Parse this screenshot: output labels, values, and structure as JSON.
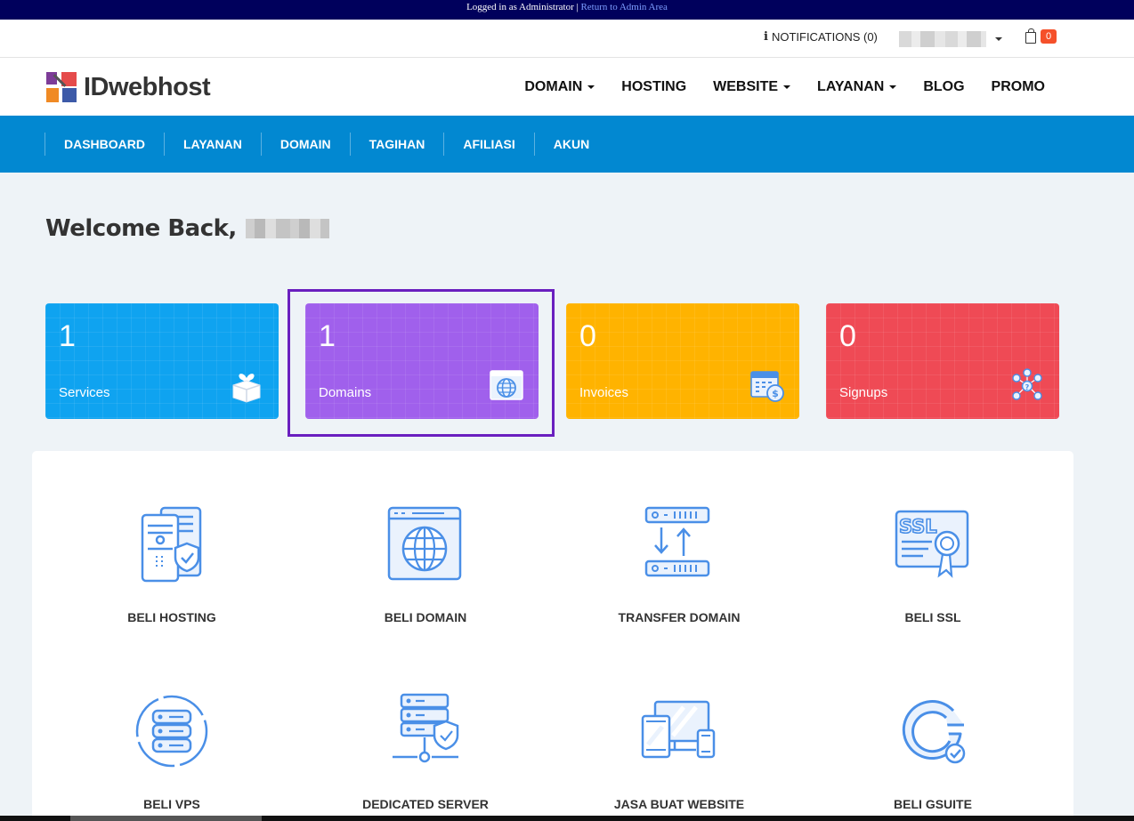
{
  "admin_bar": {
    "text": "Logged in as Administrator |",
    "link": "Return to Admin Area"
  },
  "topbar": {
    "notifications": "NOTIFICATIONS (0)",
    "cart_count": "0"
  },
  "header": {
    "logo_text": "IDwebhost",
    "nav": [
      {
        "label": "DOMAIN",
        "has_dropdown": true
      },
      {
        "label": "HOSTING",
        "has_dropdown": false
      },
      {
        "label": "WEBSITE",
        "has_dropdown": true
      },
      {
        "label": "LAYANAN",
        "has_dropdown": true
      },
      {
        "label": "BLOG",
        "has_dropdown": false
      },
      {
        "label": "PROMO",
        "has_dropdown": false
      }
    ]
  },
  "subnav": [
    "DASHBOARD",
    "LAYANAN",
    "DOMAIN",
    "TAGIHAN",
    "AFILIASI",
    "AKUN"
  ],
  "welcome": {
    "text": "Welcome Back,"
  },
  "tiles": [
    {
      "count": "1",
      "label": "Services",
      "color": "#0fa3f0",
      "icon": "gift-box-icon"
    },
    {
      "count": "1",
      "label": "Domains",
      "color": "#a060ec",
      "icon": "globe-window-icon"
    },
    {
      "count": "0",
      "label": "Invoices",
      "color": "#ffb300",
      "icon": "invoice-calendar-icon"
    },
    {
      "count": "0",
      "label": "Signups",
      "color": "#ef4a55",
      "icon": "network-users-icon"
    }
  ],
  "services": [
    {
      "label": "BELI HOSTING",
      "icon": "hosting-server-icon"
    },
    {
      "label": "BELI DOMAIN",
      "icon": "domain-globe-icon"
    },
    {
      "label": "TRANSFER DOMAIN",
      "icon": "transfer-arrows-icon"
    },
    {
      "label": "BELI SSL",
      "icon": "ssl-certificate-icon"
    },
    {
      "label": "BELI VPS",
      "icon": "vps-server-icon"
    },
    {
      "label": "DEDICATED SERVER",
      "icon": "dedicated-server-icon"
    },
    {
      "label": "JASA BUAT WEBSITE",
      "icon": "devices-icon"
    },
    {
      "label": "BELI GSUITE",
      "icon": "gsuite-icon"
    }
  ],
  "colors": {
    "admin_bar": "#00005c",
    "subnav": "#0288d1",
    "icon_stroke": "#4a8fe7",
    "highlight": "#6a1fbf"
  }
}
